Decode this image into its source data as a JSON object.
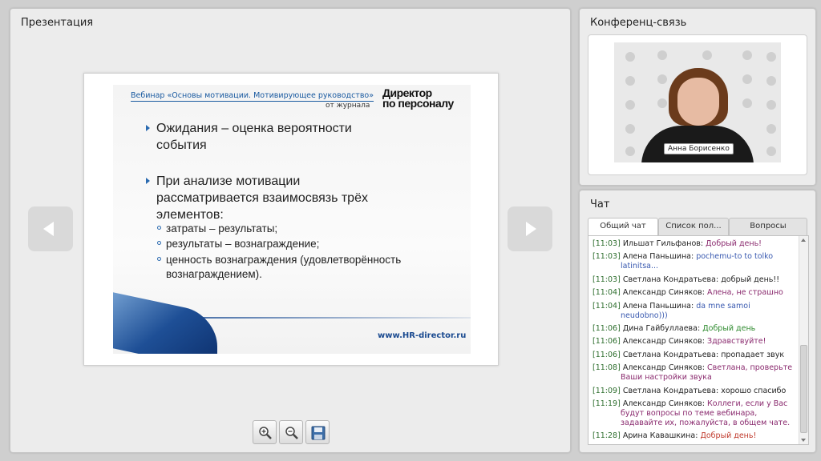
{
  "presentation": {
    "title": "Презентация",
    "slide": {
      "header": "Вебинар «Основы мотивации. Мотивирующее руководство»",
      "from": "от журнала",
      "logo_line1": "Директор",
      "logo_line2": "по персоналу",
      "bullets": [
        {
          "lines": [
            "Ожидания – оценка вероятности",
            "события"
          ]
        },
        {
          "lines": [
            "При анализе мотивации",
            "рассматривается взаимосвязь трёх",
            "элементов:"
          ]
        }
      ],
      "subbullets": [
        {
          "lines": [
            "затраты – результаты;"
          ]
        },
        {
          "lines": [
            "результаты – вознаграждение;"
          ]
        },
        {
          "lines": [
            "ценность вознаграждения (удовлетворённость",
            "вознаграждением)."
          ]
        }
      ],
      "url": "www.HR-director.ru"
    },
    "toolbar": {
      "zoom_in_icon": "zoom-in-icon",
      "zoom_out_icon": "zoom-out-icon",
      "save_icon": "save-icon"
    }
  },
  "conference": {
    "title": "Конференц-связь",
    "speaker_name": "Анна Борисенко"
  },
  "chat": {
    "title": "Чат",
    "tabs": [
      "Общий чат",
      "Список пол...",
      "Вопросы"
    ],
    "active_tab": 0,
    "messages": [
      {
        "time": "[11:03]",
        "author": "Ильшат  Гильфанов",
        "text": "Добрый день!",
        "color": "#8a2a6e"
      },
      {
        "time": "[11:03]",
        "author": "Алена Паньшина",
        "text": "pochemu-to to tolko latinitsa...",
        "color": "#3a5ab0"
      },
      {
        "time": "[11:03]",
        "author": "Светлана Кондратьева",
        "text": "добрый день!!",
        "color": "#222222"
      },
      {
        "time": "[11:04]",
        "author": "Александр Синяков",
        "text": "Алена, не страшно",
        "color": "#8a2a6e"
      },
      {
        "time": "[11:04]",
        "author": "Алена Паньшина",
        "text": "da mne samoi neudobno)))",
        "color": "#3a5ab0"
      },
      {
        "time": "[11:06]",
        "author": "Дина Гайбуллаева",
        "text": "Добрый день",
        "color": "#2e8a2e"
      },
      {
        "time": "[11:06]",
        "author": "Александр Синяков",
        "text": "Здравствуйте!",
        "color": "#8a2a6e"
      },
      {
        "time": "[11:06]",
        "author": "Светлана Кондратьева",
        "text": "пропадает звук",
        "color": "#222222"
      },
      {
        "time": "[11:08]",
        "author": "Александр Синяков",
        "text": "Светлана, проверьте Ваши настройки звука",
        "color": "#8a2a6e"
      },
      {
        "time": "[11:09]",
        "author": "Светлана Кондратьева",
        "text": "хорошо спасибо",
        "color": "#222222"
      },
      {
        "time": "[11:19]",
        "author": "Александр Синяков",
        "text": "Коллеги, если у Вас будут вопросы по теме вебинара, задавайте их, пожалуйста, в общем чате.",
        "color": "#8a2a6e"
      },
      {
        "time": "[11:28]",
        "author": "Арина Кавашкина",
        "text": "Добрый день!",
        "color": "#c0392b"
      }
    ]
  }
}
